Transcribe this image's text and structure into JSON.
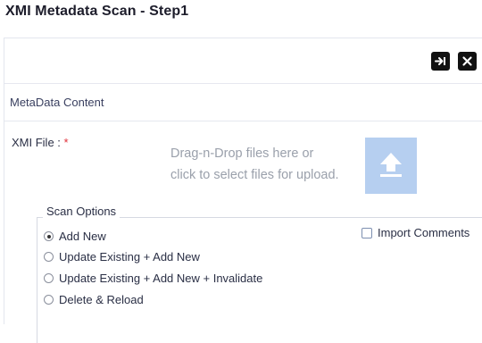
{
  "page": {
    "title": "XMI Metadata Scan - Step1"
  },
  "toolbar": {
    "next_icon": "arrow-right-to-bar-icon",
    "close_icon": "close-icon"
  },
  "section": {
    "label": "MetaData Content"
  },
  "xmi_file": {
    "label": "XMI File :",
    "required_mark": "*",
    "drop_hint_line1": "Drag-n-Drop files here or",
    "drop_hint_line2": "click to select files for upload.",
    "upload_icon": "upload-icon"
  },
  "scan_options": {
    "legend": "Scan Options",
    "options": [
      {
        "label": "Add New",
        "selected": true
      },
      {
        "label": "Update Existing + Add New",
        "selected": false
      },
      {
        "label": "Update Existing + Add New + Invalidate",
        "selected": false
      },
      {
        "label": "Delete & Reload",
        "selected": false
      }
    ],
    "import_comments": {
      "label": "Import Comments",
      "checked": false
    }
  },
  "colors": {
    "upload_box": "#b6cff0",
    "required": "#e0303a"
  }
}
